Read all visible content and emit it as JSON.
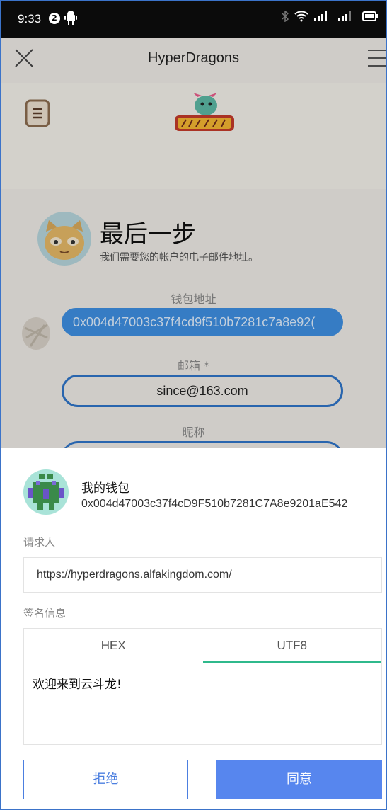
{
  "status_bar": {
    "time": "9:33",
    "notification_count": "2"
  },
  "app": {
    "title": "HyperDragons",
    "step_title": "最后一步",
    "step_subtitle": "我们需要您的帐户的电子邮件地址。",
    "wallet_address_label": "钱包地址",
    "wallet_address_value": "0x004d47003c37f4cd9f510b7281c7a8e92(",
    "email_label": "邮箱 *",
    "email_value": "since@163.com",
    "nickname_label": "昵称"
  },
  "sheet": {
    "wallet_name": "我的钱包",
    "wallet_address": "0x004d47003c37f4cD9F510b7281C7A8e9201aE542",
    "requester_label": "请求人",
    "requester_url": "https://hyperdragons.alfakingdom.com/",
    "signature_label": "签名信息",
    "tabs": [
      {
        "label": "HEX"
      },
      {
        "label": "UTF8"
      }
    ],
    "active_tab": "UTF8",
    "message": "欢迎来到云斗龙!",
    "reject_label": "拒绝",
    "agree_label": "同意"
  },
  "colors": {
    "primary": "#5786ee",
    "pill_blue": "#3e8ee0",
    "tab_underline": "#2fb98c"
  }
}
